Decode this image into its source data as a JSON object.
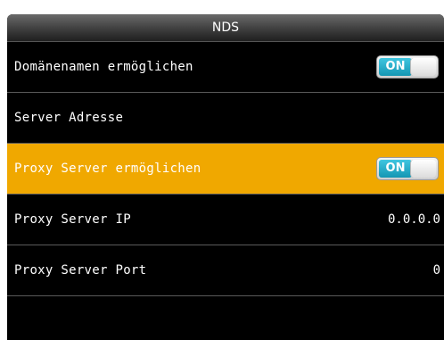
{
  "header": {
    "title": "NDS"
  },
  "settings": {
    "items": [
      {
        "label": "Domänenamen ermöglichen",
        "toggle": "ON"
      },
      {
        "label": "Server Adresse"
      },
      {
        "label": "Proxy Server ermöglichen",
        "toggle": "ON",
        "highlighted": true
      },
      {
        "label": "Proxy Server IP",
        "value": "0.0.0.0"
      },
      {
        "label": "Proxy Server Port",
        "value": "0"
      }
    ]
  },
  "colors": {
    "highlight": "#f0a800",
    "toggle_on": "#1ea8c6",
    "background": "#000000"
  }
}
